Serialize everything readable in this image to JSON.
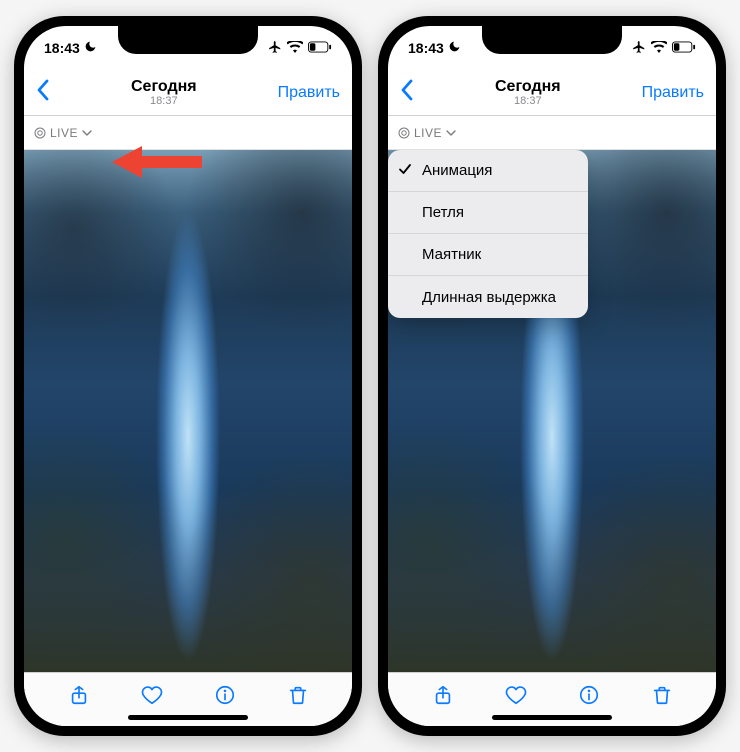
{
  "status": {
    "time": "18:43",
    "moon_icon": "moon-icon"
  },
  "nav": {
    "title": "Сегодня",
    "subtitle": "18:37",
    "edit": "Править"
  },
  "live": {
    "label": "LIVE"
  },
  "dropdown": {
    "items": [
      {
        "label": "Анимация",
        "checked": true
      },
      {
        "label": "Петля",
        "checked": false
      },
      {
        "label": "Маятник",
        "checked": false
      },
      {
        "label": "Длинная выдержка",
        "checked": false
      }
    ]
  },
  "colors": {
    "accent": "#0a7aff",
    "callout": "#ed4333"
  }
}
